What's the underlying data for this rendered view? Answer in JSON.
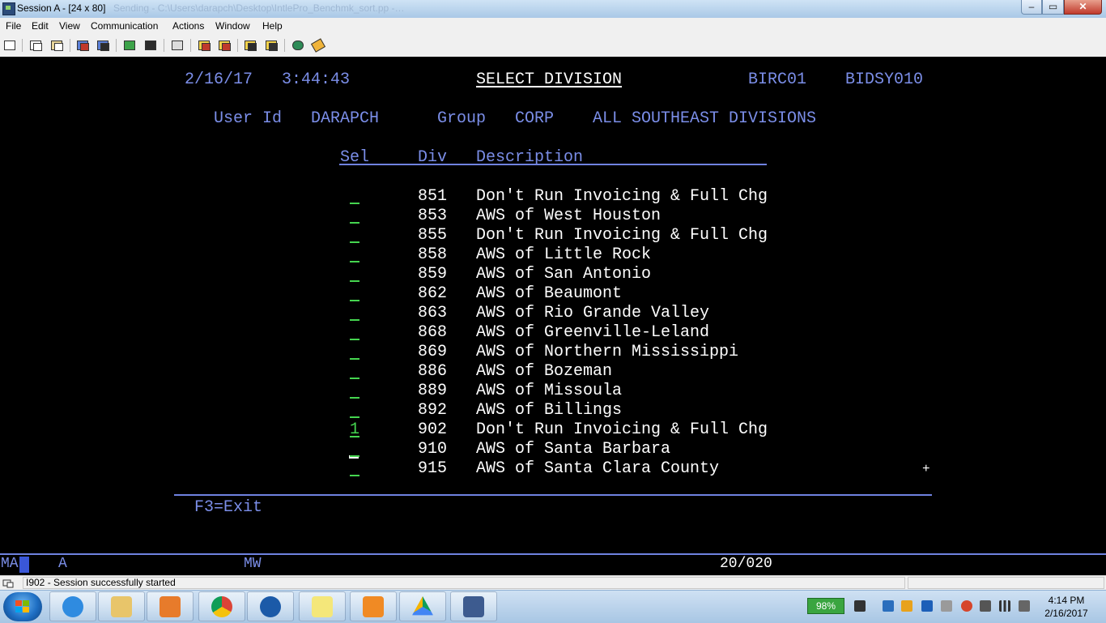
{
  "window": {
    "title": "Session A - [24 x 80]",
    "title_path": "Sending - C:\\Users\\darapch\\Desktop\\IntlePro_Benchmk_sort.pp -…",
    "controls": {
      "minimize": "–",
      "maximize": "▭",
      "close": "✕"
    }
  },
  "menu": [
    "File",
    "Edit",
    "View",
    "Communication",
    "Actions",
    "Window",
    "Help"
  ],
  "toolbar_icons": [
    "print-screen-icon",
    "copy-icon",
    "paste-icon",
    "send-file-icon",
    "receive-file-icon",
    "display-keypad-icon",
    "keyboard-map-icon",
    "record-macro-icon",
    "play-macro-icon",
    "stop-macro-icon",
    "macro-manager-icon",
    "web-help-icon",
    "customize-icon"
  ],
  "screen": {
    "date": "2/16/17",
    "time": "3:44:43",
    "title": "SELECT DIVISION",
    "system_id": "BIRC01",
    "program_id": "BIDSY010",
    "user_id_label": "User Id",
    "user_id": "DARAPCH",
    "group_label": "Group",
    "group": "CORP",
    "group_desc": "ALL SOUTHEAST DIVISIONS",
    "col_sel": "Sel",
    "col_div": "Div",
    "col_desc": "Description",
    "rows": [
      {
        "sel": "",
        "div": "851",
        "desc": "Don't Run Invoicing & Full Chg"
      },
      {
        "sel": "",
        "div": "853",
        "desc": "AWS of West Houston"
      },
      {
        "sel": "",
        "div": "855",
        "desc": "Don't Run Invoicing & Full Chg"
      },
      {
        "sel": "",
        "div": "858",
        "desc": "AWS of Little Rock"
      },
      {
        "sel": "",
        "div": "859",
        "desc": "AWS of San Antonio"
      },
      {
        "sel": "",
        "div": "862",
        "desc": "AWS of Beaumont"
      },
      {
        "sel": "",
        "div": "863",
        "desc": "AWS of Rio Grande Valley"
      },
      {
        "sel": "",
        "div": "868",
        "desc": "AWS of Greenville-Leland"
      },
      {
        "sel": "",
        "div": "869",
        "desc": "AWS of Northern Mississippi"
      },
      {
        "sel": "",
        "div": "886",
        "desc": "AWS of Bozeman"
      },
      {
        "sel": "",
        "div": "889",
        "desc": "AWS of Missoula"
      },
      {
        "sel": "",
        "div": "892",
        "desc": "AWS of Billings"
      },
      {
        "sel": "1",
        "div": "902",
        "desc": "Don't Run Invoicing & Full Chg"
      },
      {
        "sel": "",
        "div": "910",
        "desc": "AWS of Santa Barbara"
      },
      {
        "sel": "",
        "div": "915",
        "desc": "AWS of Santa Clara County"
      }
    ],
    "more_indicator": "+",
    "function_keys": "F3=Exit"
  },
  "oia": {
    "mode": "MA",
    "a": "A",
    "mw": "MW",
    "cursor_pos": "20/020"
  },
  "status": {
    "message": "I902 - Session successfully started"
  },
  "taskbar": {
    "apps": [
      "internet-explorer-icon",
      "file-explorer-icon",
      "media-player-icon",
      "chrome-icon",
      "remote-desktop-icon",
      "sticky-notes-icon",
      "outlook-icon",
      "google-drive-icon",
      "pcomm-session-icon"
    ],
    "battery": "98%",
    "time": "4:14 PM",
    "date": "2/16/2017"
  },
  "colors": {
    "field_blue": "#7b8ee8",
    "input_green": "#45d44f",
    "text_white": "#ffffff",
    "background": "#000000"
  }
}
